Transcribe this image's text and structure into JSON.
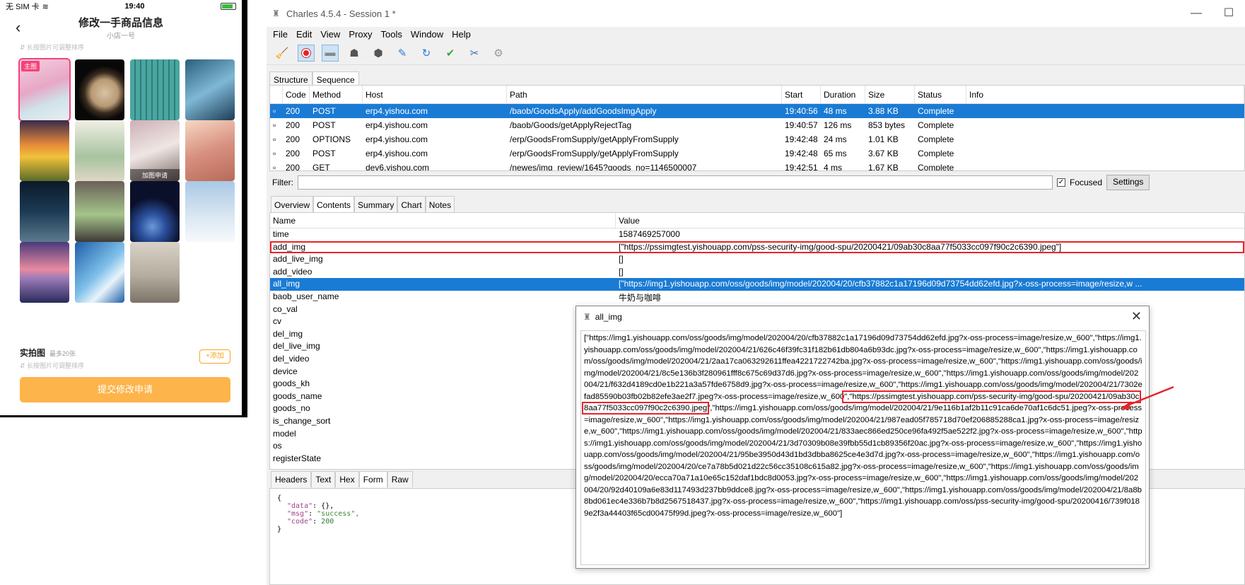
{
  "phone": {
    "carrier": "无 SIM 卡",
    "time": "19:40",
    "battery_level": 0.85,
    "page_title": "修改一手商品信息",
    "page_subtitle": "小店一号",
    "sort_hint": "长按图片可调整排序",
    "main_badge": "主图",
    "tile_caption": "加图申请",
    "real_photos_title": "实拍图",
    "real_photos_max": "最多20张",
    "real_photos_hint": "长按图片可调整排序",
    "add_button": "+添加",
    "submit_button": "提交修改申请"
  },
  "charles": {
    "window_title": "Charles 4.5.4 - Session 1 *",
    "menu": [
      "File",
      "Edit",
      "View",
      "Proxy",
      "Tools",
      "Window",
      "Help"
    ],
    "view_tabs": [
      "Structure",
      "Sequence"
    ],
    "requests": {
      "columns": [
        "Code",
        "Method",
        "Host",
        "Path",
        "Start",
        "Duration",
        "Size",
        "Status",
        "Info"
      ],
      "rows": [
        {
          "code": "200",
          "method": "POST",
          "host": "erp4.yishou.com",
          "path": "/baob/GoodsApply/addGoodsImgApply",
          "start": "19:40:56",
          "duration": "48 ms",
          "size": "3.88 KB",
          "status": "Complete",
          "info": ""
        },
        {
          "code": "200",
          "method": "POST",
          "host": "erp4.yishou.com",
          "path": "/baob/Goods/getApplyRejectTag",
          "start": "19:40:57",
          "duration": "126 ms",
          "size": "853 bytes",
          "status": "Complete",
          "info": ""
        },
        {
          "code": "200",
          "method": "OPTIONS",
          "host": "erp4.yishou.com",
          "path": "/erp/GoodsFromSupply/getApplyFromSupply",
          "start": "19:42:48",
          "duration": "24 ms",
          "size": "1.01 KB",
          "status": "Complete",
          "info": ""
        },
        {
          "code": "200",
          "method": "POST",
          "host": "erp4.yishou.com",
          "path": "/erp/GoodsFromSupply/getApplyFromSupply",
          "start": "19:42:48",
          "duration": "65 ms",
          "size": "3.67 KB",
          "status": "Complete",
          "info": ""
        },
        {
          "code": "200",
          "method": "GET",
          "host": "dev6.yishou.com",
          "path": "/newes/img_review/1645?goods_no=1146500007",
          "start": "19:42:51",
          "duration": "4 ms",
          "size": "1.67 KB",
          "status": "Complete",
          "info": ""
        }
      ]
    },
    "filter_label": "Filter:",
    "focused_label": "Focused",
    "settings_label": "Settings",
    "detail_tabs": [
      "Overview",
      "Contents",
      "Summary",
      "Chart",
      "Notes"
    ],
    "form": {
      "name_header": "Name",
      "value_header": "Value",
      "rows": [
        {
          "name": "time",
          "value": "1587469257000"
        },
        {
          "name": "add_img",
          "value": "[\"https://pssimgtest.yishouapp.com/pss-security-img/good-spu/20200421/09ab30c8aa77f5033cc097f90c2c6390.jpeg\"]"
        },
        {
          "name": "add_live_img",
          "value": "[]"
        },
        {
          "name": "add_video",
          "value": "[]"
        },
        {
          "name": "all_img",
          "value": "[\"https://img1.yishouapp.com/oss/goods/img/model/202004/20/cfb37882c1a17196d09d73754dd62efd.jpg?x-oss-process=image/resize,w ..."
        },
        {
          "name": "baob_user_name",
          "value": "牛奶与咖啡"
        },
        {
          "name": "co_val",
          "value": ""
        },
        {
          "name": "cv",
          "value": ""
        },
        {
          "name": "del_img",
          "value": ""
        },
        {
          "name": "del_live_img",
          "value": ""
        },
        {
          "name": "del_video",
          "value": ""
        },
        {
          "name": "device",
          "value": ""
        },
        {
          "name": "goods_kh",
          "value": ""
        },
        {
          "name": "goods_name",
          "value": ""
        },
        {
          "name": "goods_no",
          "value": ""
        },
        {
          "name": "is_change_sort",
          "value": ""
        },
        {
          "name": "model",
          "value": ""
        },
        {
          "name": "os",
          "value": ""
        },
        {
          "name": "registerState",
          "value": ""
        }
      ]
    },
    "bottom_tabs": [
      "Headers",
      "Text",
      "Hex",
      "Form",
      "Raw"
    ],
    "response": {
      "open": "{",
      "data_key": "\"data\"",
      "data_val": "{},",
      "msg_key": "\"msg\"",
      "msg_val": "\"success\",",
      "code_key": "\"code\"",
      "code_val": "200",
      "close": "}"
    }
  },
  "dialog": {
    "title": "all_img",
    "text_before": "[\"https://img1.yishouapp.com/oss/goods/img/model/202004/20/cfb37882c1a17196d09d73754dd62efd.jpg?x-oss-process=image/resize,w_600\",\"https://img1.yishouapp.com/oss/goods/img/model/202004/21/626c46f39fc31f182b61db804a6b93dc.jpg?x-oss-process=image/resize,w_600\",\"https://img1.yishouapp.com/oss/goods/img/model/202004/21/2aa17ca063292611ffea4221722742ba.jpg?x-oss-process=image/resize,w_600\",\"https://img1.yishouapp.com/oss/goods/img/model/202004/21/8c5e136b3f280961fff8c675c69d37d6.jpg?x-oss-process=image/resize,w_600\",\"https://img1.yishouapp.com/oss/goods/img/model/202004/21/f632d4189cd0e1b221a3a57fde6758d9.jpg?x-oss-process=image/resize,w_600\",\"https://img1.yishouapp.com/oss/goods/img/model/202004/21/7302efad85590b03fb02b82efe3ae2f7.jpeg?x-oss-process=image/resize,w_600",
    "text_marked": "\",\"https://pssimgtest.yishouapp.com/pss-security-img/good-spu/20200421/09ab30c8aa77f5033cc097f90c2c6390.jpeg",
    "text_after": "\",\"https://img1.yishouapp.com/oss/goods/img/model/202004/21/9e116b1af2b11c91ca6de70af1c6dc51.jpeg?x-oss-process=image/resize,w_600\",\"https://img1.yishouapp.com/oss/goods/img/model/202004/21/987ead05f785718d70ef206885288ca1.jpg?x-oss-process=image/resize,w_600\",\"https://img1.yishouapp.com/oss/goods/img/model/202004/21/833aec866ed250ce96fa492f5ae522f2.jpg?x-oss-process=image/resize,w_600\",\"https://img1.yishouapp.com/oss/goods/img/model/202004/21/3d70309b08e39fbb55d1cb89356f20ac.jpg?x-oss-process=image/resize,w_600\",\"https://img1.yishouapp.com/oss/goods/img/model/202004/21/95be3950d43d1bd3dbba8625ce4e3d7d.jpg?x-oss-process=image/resize,w_600\",\"https://img1.yishouapp.com/oss/goods/img/model/202004/20/ce7a78b5d021d22c56cc35108c615a82.jpg?x-oss-process=image/resize,w_600\",\"https://img1.yishouapp.com/oss/goods/img/model/202004/20/ecca70a71a10e65c152daf1bdc8d0053.jpg?x-oss-process=image/resize,w_600\",\"https://img1.yishouapp.com/oss/goods/img/model/202004/20/92d40109a6e83d117493d237bb9ddce8.jpg?x-oss-process=image/resize,w_600\",\"https://img1.yishouapp.com/oss/goods/img/model/202004/21/8a8b8bd061ec4e336b7b8d2567518437.jpg?x-oss-process=image/resize,w_600\",\"https://img1.yishouapp.com/oss/pss-security-img/good-spu/20200416/739f0189e2f3a44403f65cd00475f99d.jpeg?x-oss-process=image/resize,w_600\"]"
  },
  "colors": {
    "selection_blue": "#1a7bd4",
    "highlight_red": "#e8232b",
    "submit_orange": "#fdb44b",
    "badge_pink": "#f5427a"
  }
}
